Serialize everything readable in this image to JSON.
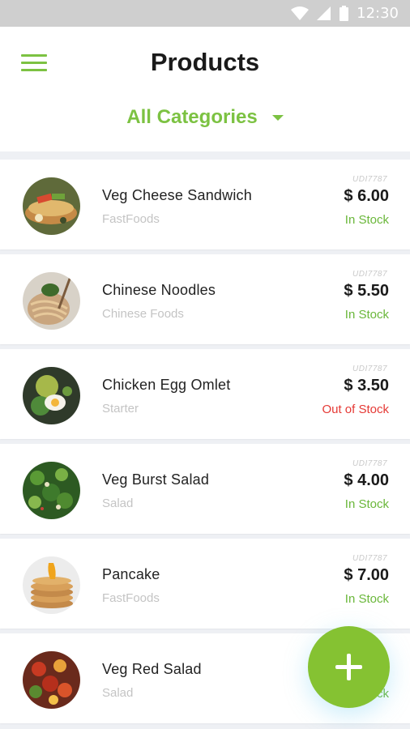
{
  "status_bar": {
    "time": "12:30"
  },
  "header": {
    "title": "Products",
    "category_filter": "All Categories"
  },
  "colors": {
    "accent": "#7cc242",
    "in_stock": "#6ab73a",
    "out_of_stock": "#e53935"
  },
  "products": [
    {
      "sku": "UDI7787",
      "name": "Veg Cheese Sandwich",
      "category": "FastFoods",
      "price": "$ 6.00",
      "stock": "In Stock",
      "in_stock": true
    },
    {
      "sku": "UDI7787",
      "name": "Chinese Noodles",
      "category": "Chinese Foods",
      "price": "$ 5.50",
      "stock": "In Stock",
      "in_stock": true
    },
    {
      "sku": "UDI7787",
      "name": "Chicken Egg Omlet",
      "category": "Starter",
      "price": "$ 3.50",
      "stock": "Out of Stock",
      "in_stock": false
    },
    {
      "sku": "UDI7787",
      "name": "Veg Burst Salad",
      "category": "Salad",
      "price": "$ 4.00",
      "stock": "In Stock",
      "in_stock": true
    },
    {
      "sku": "UDI7787",
      "name": "Pancake",
      "category": "FastFoods",
      "price": "$ 7.00",
      "stock": "In Stock",
      "in_stock": true
    },
    {
      "sku": "",
      "name": "Veg Red Salad",
      "category": "Salad",
      "price": "",
      "stock": "ck",
      "in_stock": true
    }
  ]
}
